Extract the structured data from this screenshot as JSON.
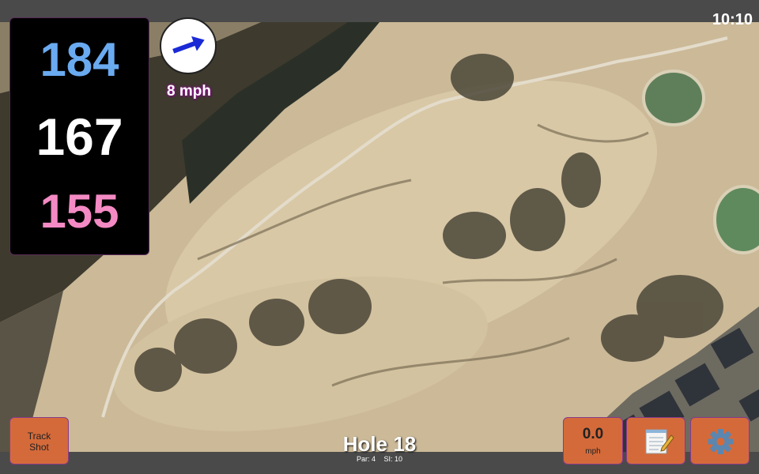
{
  "status": {
    "time": "10:10"
  },
  "yardages": {
    "back": "184",
    "middle": "167",
    "front": "155"
  },
  "wind": {
    "speed": "8 mph",
    "icon": "wind-arrow-icon"
  },
  "hole": {
    "title": "Hole 18",
    "par": "Par: 4",
    "si": "SI: 10"
  },
  "buttons": {
    "track_shot_line1": "Track",
    "track_shot_line2": "Shot",
    "speed_value": "0.0",
    "speed_unit": "mph",
    "notes_icon": "notepad-icon",
    "settings_icon": "gear-icon"
  },
  "colors": {
    "back": "#6aaaf0",
    "middle": "#ffffff",
    "front": "#f48ac4",
    "button": "#d46a3a"
  }
}
